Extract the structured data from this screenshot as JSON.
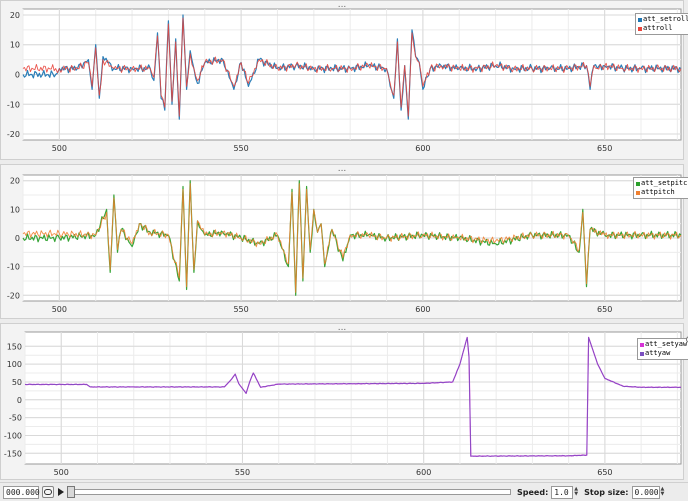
{
  "panels": [
    {
      "handle": "...",
      "y_ticks": [
        "20",
        "10",
        "0",
        "-10",
        "-20"
      ],
      "y_tick_values": [
        20,
        10,
        0,
        -10,
        -20
      ],
      "ylim": [
        -22,
        22
      ],
      "x_ticks": [
        "500",
        "550",
        "600",
        "650"
      ],
      "x_tick_values": [
        500,
        550,
        600,
        650
      ],
      "xlim": [
        490,
        671
      ],
      "series": [
        {
          "name": "att_setroll",
          "color": "#1f77b4"
        },
        {
          "name": "attroll",
          "color": "#e8453c"
        }
      ]
    },
    {
      "handle": "...",
      "y_ticks": [
        "20",
        "10",
        "0",
        "-10",
        "-20"
      ],
      "y_tick_values": [
        20,
        10,
        0,
        -10,
        -20
      ],
      "ylim": [
        -22,
        22
      ],
      "x_ticks": [
        "500",
        "550",
        "600",
        "650"
      ],
      "x_tick_values": [
        500,
        550,
        600,
        650
      ],
      "xlim": [
        490,
        671
      ],
      "series": [
        {
          "name": "att_setpitch",
          "color": "#2ca02c"
        },
        {
          "name": "attpitch",
          "color": "#f08030"
        }
      ]
    },
    {
      "handle": "...",
      "y_ticks": [
        "150",
        "100",
        "50",
        "0",
        "-50",
        "-100",
        "-150"
      ],
      "y_tick_values": [
        150,
        100,
        50,
        0,
        -50,
        -100,
        -150
      ],
      "ylim": [
        -180,
        190
      ],
      "x_ticks": [
        "500",
        "550",
        "600",
        "650"
      ],
      "x_tick_values": [
        500,
        550,
        600,
        650
      ],
      "xlim": [
        490,
        671
      ],
      "series": [
        {
          "name": "att_setyaw",
          "color": "#d633d6"
        },
        {
          "name": "attyaw",
          "color": "#7a4fc0"
        }
      ]
    }
  ],
  "chart_data": [
    {
      "type": "line",
      "xlim": [
        490,
        671
      ],
      "ylim": [
        -22,
        22
      ],
      "series": [
        {
          "name": "att_setroll",
          "x": [
            490,
            499,
            500,
            505,
            508,
            509,
            510,
            511,
            512,
            515,
            520,
            525,
            526,
            527,
            528,
            529,
            530,
            531,
            532,
            533,
            534,
            535,
            536,
            537,
            538,
            540,
            545,
            548,
            550,
            552,
            555,
            560,
            565,
            570,
            575,
            580,
            585,
            590,
            591,
            592,
            593,
            594,
            595,
            596,
            597,
            598,
            599,
            600,
            602,
            605,
            610,
            615,
            620,
            625,
            630,
            635,
            640,
            645,
            646,
            647,
            648,
            650,
            655,
            660,
            665,
            671
          ],
          "y": [
            0,
            0,
            2,
            2,
            5,
            -5,
            10,
            -8,
            6,
            2,
            2,
            2,
            -2,
            14,
            -8,
            -12,
            18,
            -10,
            12,
            -15,
            20,
            -5,
            8,
            2,
            -3,
            4,
            5,
            -5,
            4,
            -4,
            5,
            2,
            3,
            2,
            2,
            2,
            3,
            2,
            -4,
            -8,
            12,
            -12,
            3,
            -15,
            15,
            6,
            4,
            -5,
            2,
            3,
            2,
            2,
            3,
            2,
            2,
            2,
            2,
            3,
            -5,
            3,
            2,
            3,
            2,
            2,
            2,
            2
          ]
        },
        {
          "name": "attroll",
          "x": [
            490,
            499,
            500,
            505,
            508,
            509,
            510,
            511,
            512,
            515,
            520,
            525,
            526,
            527,
            528,
            529,
            530,
            531,
            532,
            533,
            534,
            535,
            536,
            537,
            538,
            540,
            545,
            548,
            550,
            552,
            555,
            560,
            565,
            570,
            575,
            580,
            585,
            590,
            591,
            592,
            593,
            594,
            595,
            596,
            597,
            598,
            599,
            600,
            602,
            605,
            610,
            615,
            620,
            625,
            630,
            635,
            640,
            645,
            646,
            647,
            648,
            650,
            655,
            660,
            665,
            671
          ],
          "y": [
            2,
            2,
            2,
            2,
            4,
            -4,
            9,
            -7,
            5,
            2,
            2,
            2,
            -1,
            13,
            -7,
            -11,
            17,
            -9,
            11,
            -14,
            19,
            -4,
            7,
            2,
            -2,
            4,
            5,
            -4,
            4,
            -3,
            5,
            2,
            3,
            2,
            2,
            2,
            3,
            2,
            -3,
            -7,
            11,
            -11,
            3,
            -14,
            14,
            6,
            4,
            -4,
            2,
            3,
            2,
            2,
            3,
            2,
            2,
            2,
            2,
            3,
            -4,
            3,
            2,
            3,
            2,
            2,
            2,
            2
          ]
        }
      ]
    },
    {
      "type": "line",
      "xlim": [
        490,
        671
      ],
      "ylim": [
        -22,
        22
      ],
      "series": [
        {
          "name": "att_setpitch",
          "x": [
            490,
            500,
            510,
            513,
            514,
            515,
            516,
            517,
            520,
            522,
            525,
            530,
            533,
            534,
            535,
            536,
            537,
            538,
            539,
            540,
            545,
            550,
            555,
            560,
            563,
            564,
            565,
            566,
            567,
            568,
            569,
            570,
            571,
            572,
            573,
            575,
            578,
            580,
            585,
            590,
            600,
            610,
            620,
            630,
            640,
            643,
            644,
            645,
            646,
            650,
            660,
            671
          ],
          "y": [
            0,
            0,
            1,
            10,
            -12,
            15,
            -5,
            3,
            -3,
            5,
            2,
            1,
            -15,
            18,
            -18,
            20,
            -12,
            6,
            3,
            1,
            2,
            0,
            -2,
            1,
            -10,
            17,
            -20,
            20,
            -15,
            18,
            -5,
            10,
            2,
            5,
            -10,
            3,
            -8,
            1,
            1,
            0,
            1,
            0,
            -2,
            1,
            1,
            -5,
            10,
            -17,
            3,
            1,
            1,
            1
          ]
        },
        {
          "name": "attpitch",
          "x": [
            490,
            500,
            510,
            513,
            514,
            515,
            516,
            517,
            520,
            522,
            525,
            530,
            533,
            534,
            535,
            536,
            537,
            538,
            539,
            540,
            545,
            550,
            555,
            560,
            563,
            564,
            565,
            566,
            567,
            568,
            569,
            570,
            571,
            572,
            573,
            575,
            578,
            580,
            585,
            590,
            600,
            610,
            620,
            630,
            640,
            643,
            644,
            645,
            646,
            650,
            660,
            671
          ],
          "y": [
            1.5,
            1.5,
            1,
            9,
            -11,
            14,
            -4,
            3,
            -2,
            5,
            2,
            1,
            -14,
            17,
            -17,
            19,
            -11,
            6,
            3,
            1,
            2,
            0,
            -2,
            1,
            -9,
            16,
            -19,
            19,
            -14,
            17,
            -4,
            10,
            2,
            5,
            -9,
            3,
            -7,
            1,
            1,
            0,
            1,
            0,
            -1,
            1,
            1,
            -4,
            9,
            -16,
            3,
            1,
            1,
            1
          ]
        }
      ]
    },
    {
      "type": "line",
      "xlim": [
        490,
        671
      ],
      "ylim": [
        -180,
        190
      ],
      "series": [
        {
          "name": "att_setyaw",
          "x": [
            490,
            507,
            508,
            520,
            545,
            547,
            548,
            549,
            551,
            552,
            553,
            555,
            560,
            580,
            600,
            608,
            610,
            612,
            612.5,
            613,
            640,
            645,
            645.5,
            646,
            648,
            650,
            655,
            660,
            671
          ],
          "y": [
            43,
            43,
            36,
            36,
            36,
            58,
            72,
            45,
            18,
            50,
            75,
            35,
            44,
            45,
            46,
            50,
            100,
            175,
            120,
            -158,
            -157,
            -155,
            175,
            160,
            100,
            60,
            38,
            35,
            35
          ]
        },
        {
          "name": "attyaw",
          "x": [
            490,
            507,
            508,
            520,
            545,
            547,
            548,
            549,
            551,
            552,
            553,
            555,
            560,
            580,
            600,
            608,
            610,
            612,
            612.5,
            613,
            640,
            645,
            645.5,
            646,
            648,
            650,
            655,
            660,
            671
          ],
          "y": [
            43,
            43,
            36,
            36,
            36,
            58,
            72,
            45,
            18,
            50,
            75,
            35,
            44,
            45,
            46,
            50,
            100,
            175,
            120,
            -158,
            -157,
            -155,
            175,
            160,
            100,
            60,
            38,
            35,
            35
          ]
        }
      ]
    }
  ],
  "bottom": {
    "time_value": "000.000",
    "speed_label": "Speed:",
    "speed_value": "1.0",
    "step_label": "Stop size:",
    "step_value": "0.000",
    "slider_fraction": 0.0
  }
}
